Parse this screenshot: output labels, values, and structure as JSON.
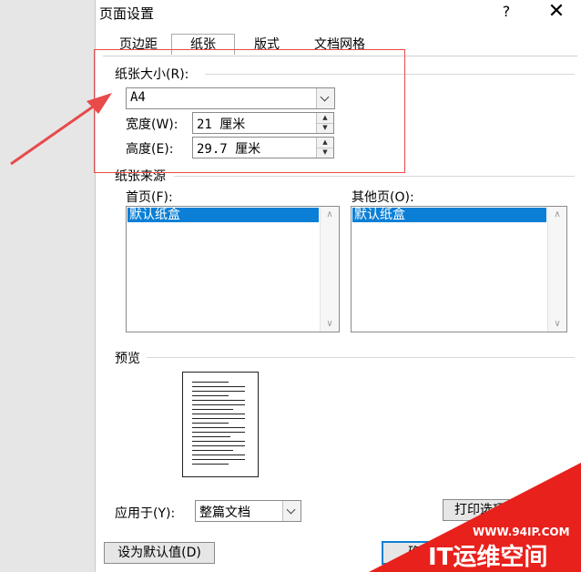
{
  "dialog": {
    "title": "页面设置",
    "help": "?",
    "close": "✕"
  },
  "tabs": [
    "页边距",
    "纸张",
    "版式",
    "文档网格"
  ],
  "paper_size": {
    "group_label": "纸张大小(R):",
    "selected": "A4",
    "width_label": "宽度(W):",
    "width_value": "21 厘米",
    "height_label": "高度(E):",
    "height_value": "29.7 厘米"
  },
  "paper_source": {
    "group_label": "纸张来源",
    "first_page_label": "首页(F):",
    "first_page_selected": "默认纸盒",
    "other_pages_label": "其他页(O):",
    "other_pages_selected": "默认纸盒"
  },
  "preview": {
    "group_label": "预览"
  },
  "apply_to": {
    "label": "应用于(Y):",
    "value": "整篇文档"
  },
  "buttons": {
    "print_options": "打印选项",
    "set_default": "设为默认值(D)",
    "ok": "确定"
  },
  "watermark": {
    "url": "WWW.94IP.COM",
    "brand": "IT运维空间"
  },
  "colors": {
    "highlight": "#e84a4a",
    "selection": "#0b7fd6",
    "watermark": "#e8211c"
  }
}
